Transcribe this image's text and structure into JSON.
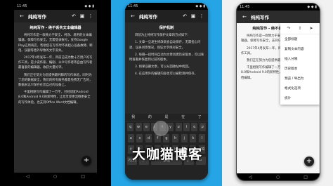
{
  "app_title": "纯纯写作",
  "status": {
    "left": "11:45",
    "right": "◆ ◆ ▮"
  },
  "screen1": {
    "heading": "纯纯写作 - 绝不丢失文本编辑器",
    "paragraphs": [
      "纯纯写作是一款致力于安全、纯净、易用的文本编辑器，保障写作安全，无需登录账号，支持Google Play应用商店，帮助您在写作时不再担心设备故障、断电、误删等意外导致的文字丢失。",
      "2017年4月发布一年，目前已成为数十万用户的写作工具，是小说作家、编剧、公众号作者等自由写作者最喜爱的编辑器，收获大量好评。",
      "我们正在努力为您提供最纯粹的写作体验，同时为了您的数据安全，我们的所有服务都是免费无广告的，数据永远只保存在您自己的设备上。",
      "千里相随写作编辑了一万字，已经适配Android 8.0和Android 9.0的新特性，让您享受更流畅更安全的写作体验，也支持Office Word文档编辑。"
    ]
  },
  "screen2": {
    "heading": "保护机制",
    "paragraphs": [
      "目前为止纯纯写作保护文章的方式如下：",
      "1. 文章一旦发生修改就会自动保存，无需担心闪退、误关闭等情况，保证文字绝对安全。",
      "2. 每隔一段时间自动为文章创建历史版本，可以随时查看并恢复到以前的版本。",
      "3. 如果误删文章，可以从回收站中找回。",
      "4. 在应用外的编辑内容也可以被检测并保存。"
    ],
    "keyboard": {
      "suggestions": [
        "我",
        "的",
        "是",
        "在",
        "了"
      ],
      "row1": [
        "q",
        "w",
        "e",
        "r",
        "t",
        "y",
        "u",
        "i",
        "o",
        "p"
      ],
      "row2": [
        "a",
        "s",
        "d",
        "f",
        "g",
        "h",
        "j",
        "k",
        "l"
      ],
      "row3": [
        "⇧",
        "z",
        "x",
        "c",
        "v",
        "b",
        "n",
        "m",
        "⌫"
      ],
      "row4": [
        "?123",
        "，",
        "空格",
        "。",
        "↵"
      ]
    }
  },
  "watermark": "大咖猫博客",
  "screen3": {
    "heading": "纯纯写作 - 绝不丢失文本编辑器",
    "paragraphs": [
      "纯纯写作是一款致力于安全、纯净、易用的文本编辑器，保障写作安全，支持Google Play应用商店。",
      "2017年4月发布一年，目前已成为数十万用户的写作工具。",
      "我们正在努力为您提供最纯粹的写作体验。",
      "千里相随写作编辑了一万字，已经适配Android 8.0和Android 9.0的新特性，也支持Office Word文档编辑。"
    ],
    "menu_items": [
      "全部标题",
      "复制文本内容",
      "插入分隔",
      "历史版本",
      "预览 / 导出为",
      "格式化选项",
      "统计"
    ]
  },
  "colors": {
    "left_bg": "#000000",
    "mid_bg": "#26a5e6",
    "right_bg": "#f1f1f1"
  }
}
